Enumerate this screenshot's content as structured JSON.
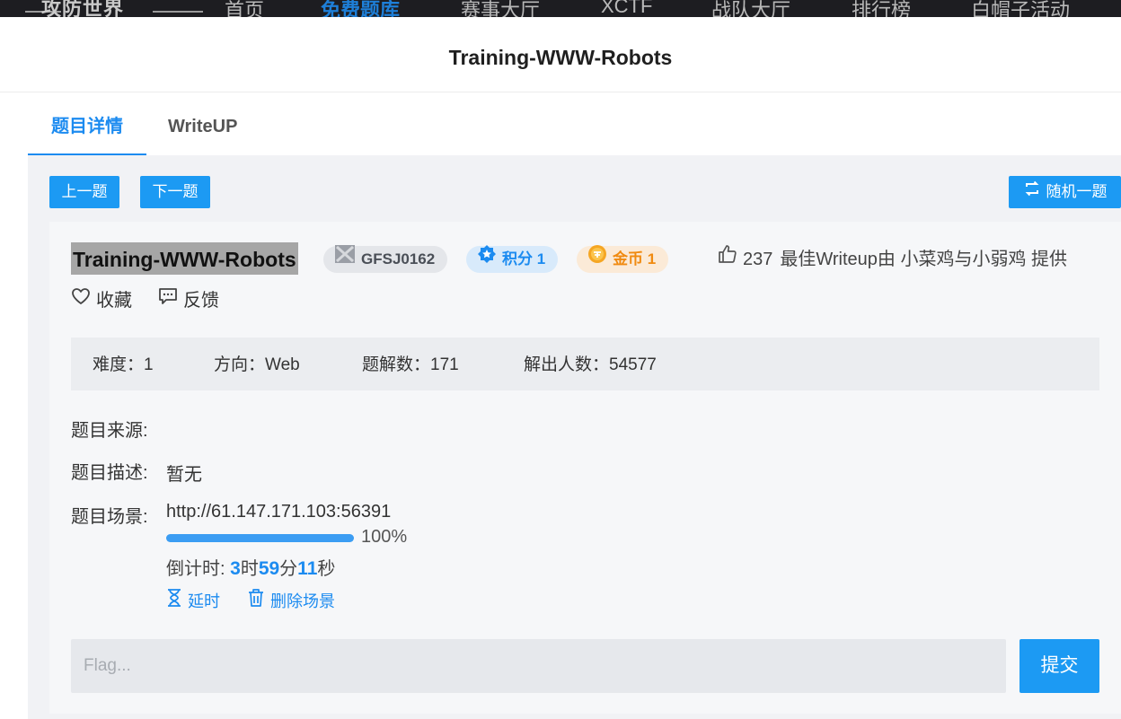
{
  "topnav": {
    "logo": "攻防世界",
    "items": [
      {
        "label": "首页",
        "active": false
      },
      {
        "label": "免费题库",
        "active": true
      },
      {
        "label": "赛事大厅",
        "active": false
      },
      {
        "label": "XCTF",
        "active": false
      },
      {
        "label": "战队大厅",
        "active": false
      },
      {
        "label": "排行榜",
        "active": false
      },
      {
        "label": "白帽子活动",
        "active": false
      }
    ]
  },
  "page_title": "Training-WWW-Robots",
  "tabs": [
    {
      "label": "题目详情",
      "active": true
    },
    {
      "label": "WriteUP",
      "active": false
    }
  ],
  "toolbar": {
    "prev_label": "上一题",
    "next_label": "下一题",
    "random_label": "随机一题"
  },
  "challenge": {
    "name": "Training-WWW-Robots",
    "code": "GFSJ0162",
    "score_label": "积分 1",
    "coin_label": "金币 1",
    "likes": "237",
    "best_writeup": "最佳Writeup由 小菜鸡与小弱鸡 提供",
    "favorite_label": "收藏",
    "feedback_label": "反馈"
  },
  "stats": {
    "difficulty": "难度：1",
    "direction": "方向：Web",
    "writeups": "题解数：171",
    "solvers": "解出人数：54577"
  },
  "details": {
    "source_label": "题目来源:",
    "source_value": "",
    "desc_label": "题目描述:",
    "desc_value": "暂无",
    "scene_label": "题目场景:",
    "scene_value": "http://61.147.171.103:56391",
    "progress": 100,
    "progress_text": "100%",
    "countdown_prefix": "倒计时: ",
    "countdown_h": "3",
    "countdown_h_unit": "时",
    "countdown_m": "59",
    "countdown_m_unit": "分",
    "countdown_s": "11",
    "countdown_s_unit": "秒",
    "delay_label": "延时",
    "delete_label": "删除场景"
  },
  "flag": {
    "placeholder": "Flag...",
    "value": "",
    "submit_label": "提交"
  },
  "colors": {
    "accent": "#1c9af3",
    "coin": "#f08a10",
    "panel_bg": "#f1f2f5"
  }
}
